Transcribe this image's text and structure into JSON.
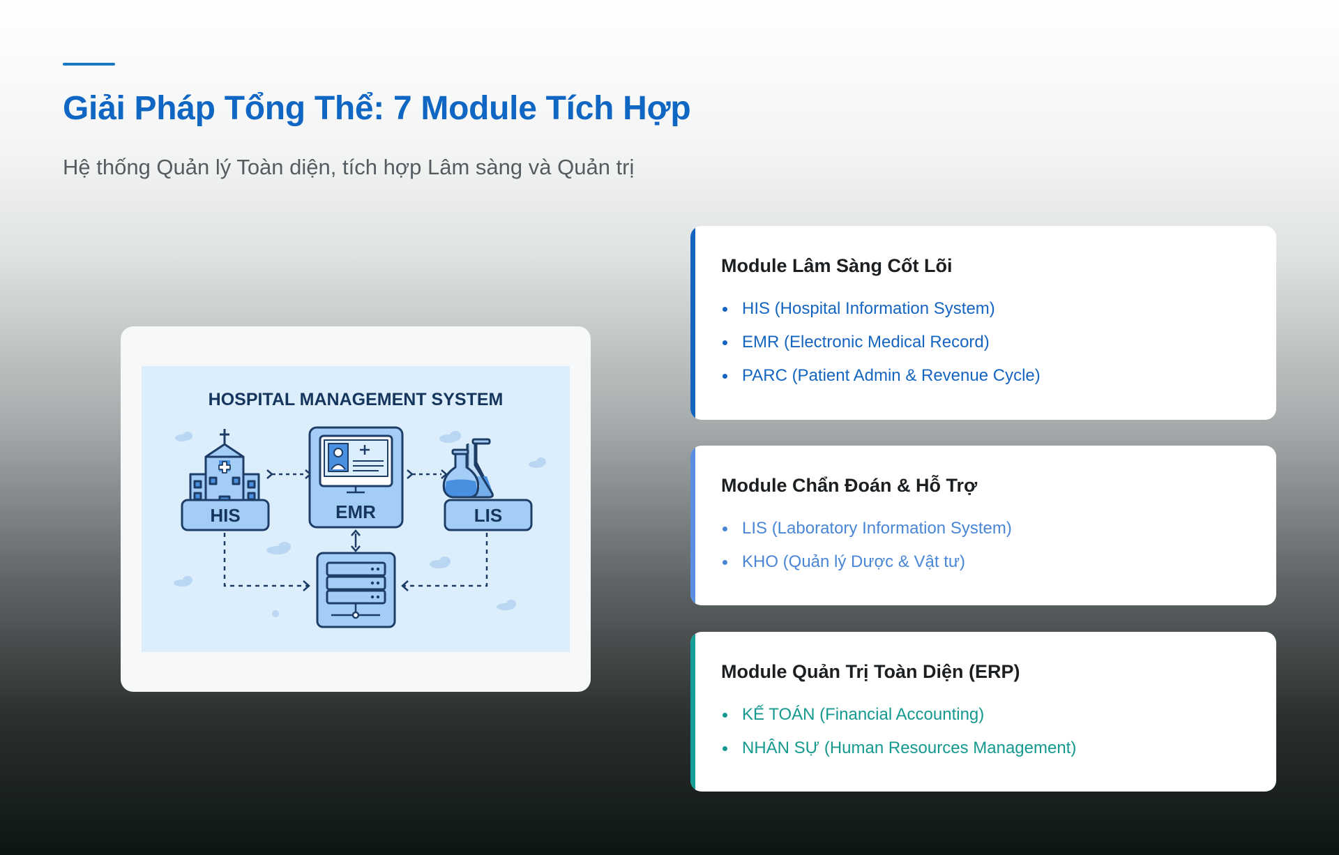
{
  "header": {
    "title": "Giải Pháp Tổng Thể: 7 Module Tích Hợp",
    "subtitle": "Hệ thống Quản lý Toàn diện, tích hợp Lâm sàng và Quản trị"
  },
  "illustration": {
    "heading": "HOSPITAL MANAGEMENT SYSTEM",
    "labels": {
      "his": "HIS",
      "emr": "EMR",
      "lis": "LIS"
    },
    "icons": [
      "hospital-icon",
      "emr-monitor-icon",
      "lab-flask-icon",
      "database-server-icon"
    ]
  },
  "cards": [
    {
      "title": "Module Lâm Sàng Cốt Lõi",
      "accent": "#1565c0",
      "item_color": "#1565c0",
      "items": [
        "HIS (Hospital Information System)",
        "EMR (Electronic Medical Record)",
        "PARC (Patient Admin & Revenue Cycle)"
      ]
    },
    {
      "title": "Module Chẩn Đoán & Hỗ Trợ",
      "accent": "#5b8ee0",
      "item_color": "#4a86d6",
      "items": [
        "LIS (Laboratory Information System)",
        "KHO (Quản lý Dược & Vật tư)"
      ]
    },
    {
      "title": "Module Quản Trị Toàn Diện (ERP)",
      "accent": "#159f96",
      "item_color": "#15998f",
      "items": [
        "KẾ TOÁN (Financial Accounting)",
        "NHÂN SỰ (Human Resources Management)"
      ]
    }
  ]
}
